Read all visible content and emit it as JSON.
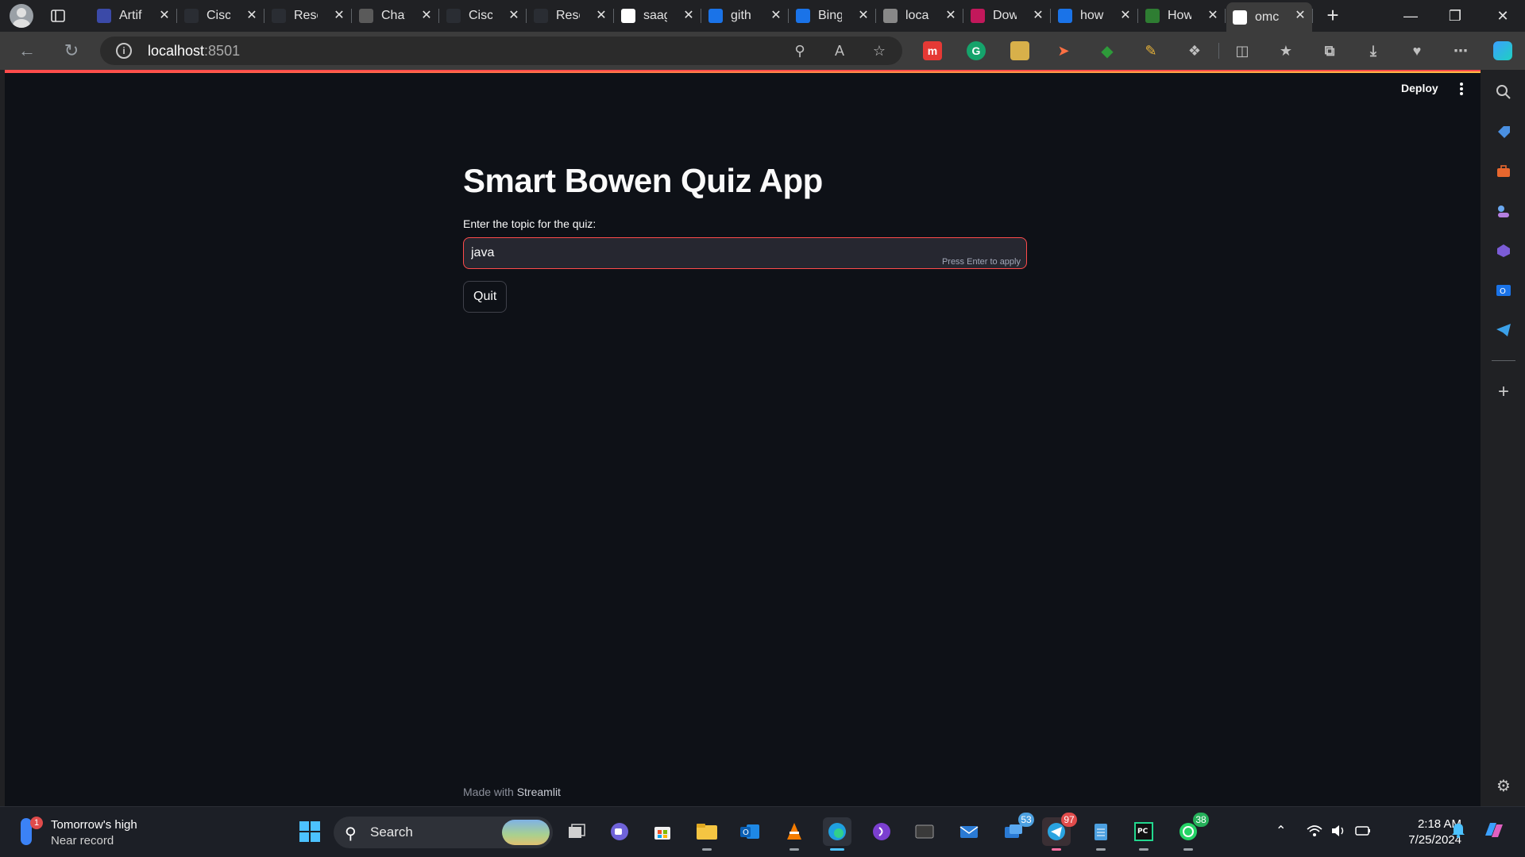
{
  "browser": {
    "tabs": [
      {
        "title": "Artif",
        "favicon": "artifact-icon",
        "color": "#3b4aa8"
      },
      {
        "title": "Cisc",
        "favicon": "cisco-icon",
        "color": "#2a2d33"
      },
      {
        "title": "Reso",
        "favicon": "resource-icon",
        "color": "#2a2d33"
      },
      {
        "title": "Chat",
        "favicon": "chatgpt-icon",
        "color": "#5a5a5a"
      },
      {
        "title": "Cisc",
        "favicon": "cisco-icon",
        "color": "#2a2d33"
      },
      {
        "title": "Reso",
        "favicon": "resource-icon",
        "color": "#2a2d33"
      },
      {
        "title": "saag",
        "favicon": "github-icon",
        "color": "#ffffff"
      },
      {
        "title": "gith",
        "favicon": "search-icon",
        "color": "#1a73e8"
      },
      {
        "title": "Bing",
        "favicon": "search-icon",
        "color": "#1a73e8"
      },
      {
        "title": "local",
        "favicon": "link-icon",
        "color": "#888888"
      },
      {
        "title": "Dow",
        "favicon": "download-page-icon",
        "color": "#c2185b"
      },
      {
        "title": "how",
        "favicon": "search-icon",
        "color": "#1a73e8"
      },
      {
        "title": "How",
        "favicon": "green-page-icon",
        "color": "#2e7d32"
      },
      {
        "title": "omc",
        "favicon": "streamlit-crown-icon",
        "color": "#ffffff"
      }
    ],
    "active_tab_index": 13,
    "address": {
      "host": "localhost",
      "port": ":8501"
    }
  },
  "app": {
    "header": {
      "deploy_label": "Deploy"
    },
    "title": "Smart Bowen Quiz App",
    "topic_input": {
      "label": "Enter the topic for the quiz:",
      "value": "java",
      "hint": "Press Enter to apply"
    },
    "quit_label": "Quit",
    "footer": {
      "prefix": "Made with",
      "brand": "Streamlit"
    }
  },
  "taskbar": {
    "weather": {
      "badge": "1",
      "line1": "Tomorrow's high",
      "line2": "Near record"
    },
    "search_label": "Search",
    "badges": {
      "messages": "53",
      "telegram": "97",
      "whatsapp": "38"
    },
    "clock": {
      "time": "2:18 AM",
      "date": "7/25/2024"
    }
  },
  "colors": {
    "accent": "#ff4b4b",
    "page_bg": "#0e1117",
    "input_bg": "#262730"
  }
}
